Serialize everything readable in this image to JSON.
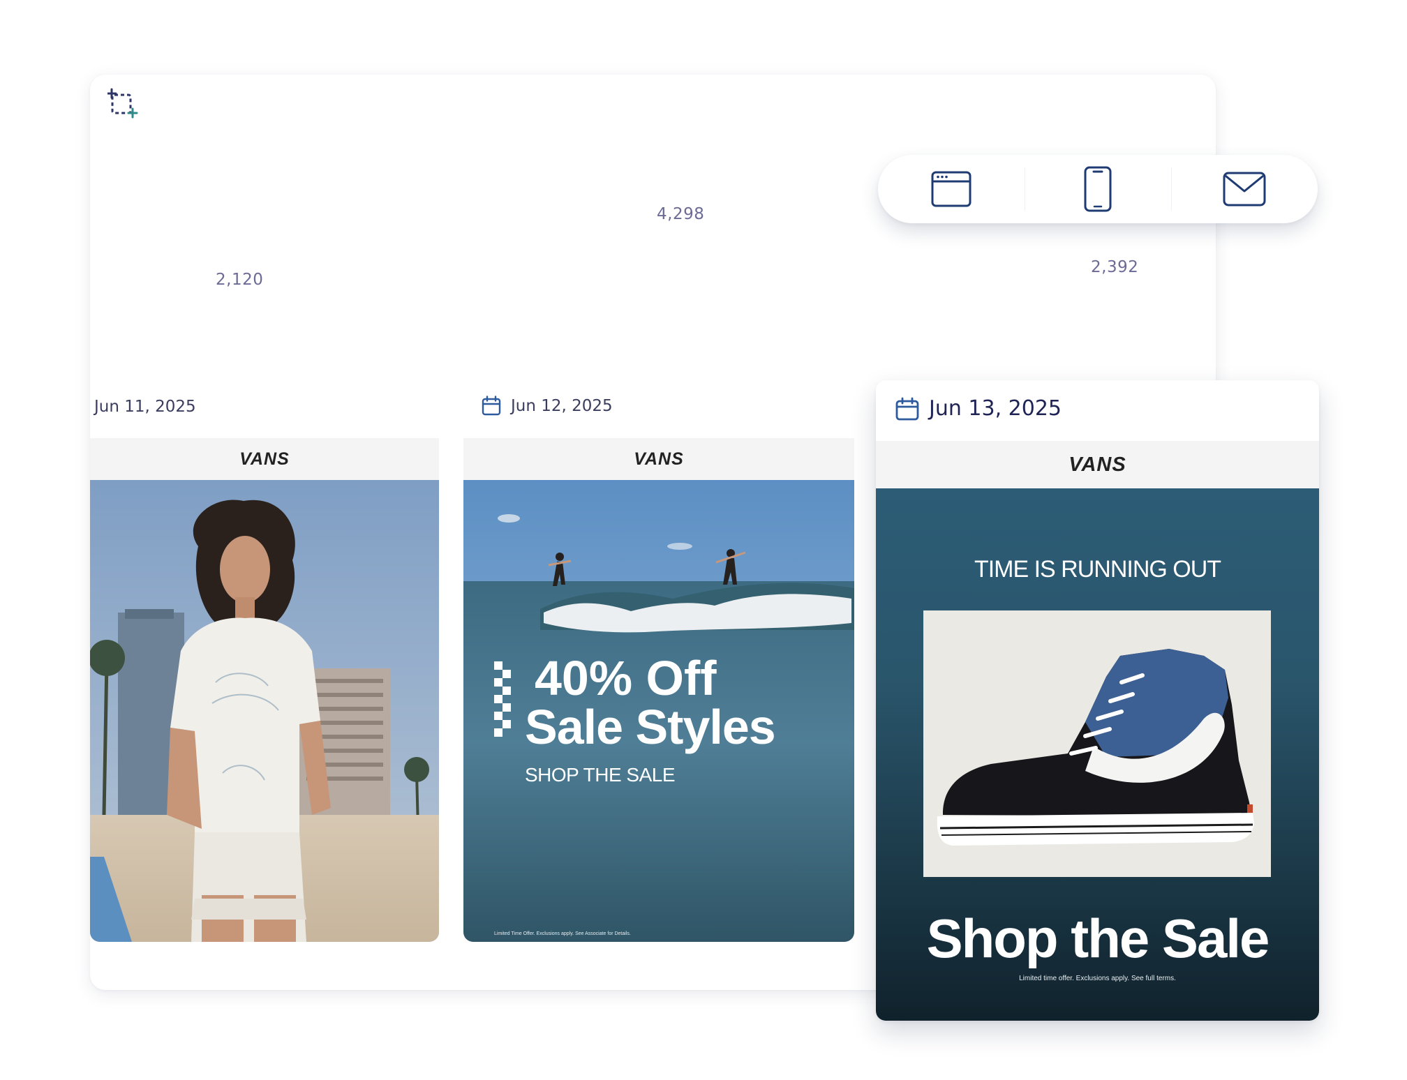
{
  "metrics": {
    "count_1": "2,120",
    "count_2": "4,298",
    "count_3": "2,392"
  },
  "channel_switch": {
    "items": [
      {
        "icon": "browser-window-icon"
      },
      {
        "icon": "mobile-phone-icon"
      },
      {
        "icon": "envelope-icon"
      }
    ],
    "selected": "envelope"
  },
  "cards": [
    {
      "date": "Jun 11, 2025",
      "brand": "VANS"
    },
    {
      "date": "Jun 12, 2025",
      "brand": "VANS",
      "headline_1": "40% Off",
      "headline_2": "Sale Styles",
      "cta": "SHOP THE SALE",
      "fine_print": "Limited Time Offer. Exclusions apply. See Associate for Details."
    },
    {
      "date": "Jun 13, 2025",
      "brand": "VANS",
      "kicker": "TIME IS RUNNING OUT",
      "headline": "Shop the Sale",
      "fine_print": "Limited time offer. Exclusions apply. See full terms."
    }
  ],
  "colors": {
    "accent_navy": "#1f3b73",
    "count_text": "#6b6b96",
    "ocean_dark": "#1d3e51"
  }
}
